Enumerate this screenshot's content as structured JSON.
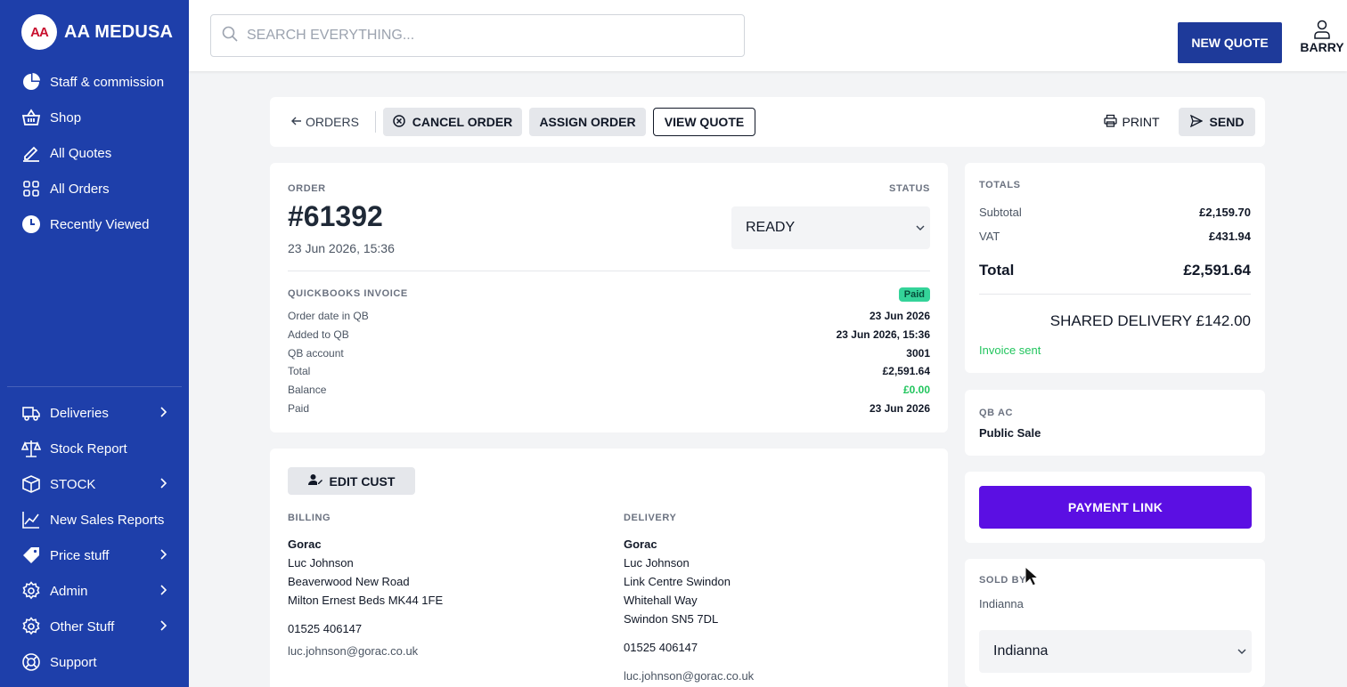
{
  "brand": {
    "logo_text": "AA",
    "name": "AA MEDUSA"
  },
  "sidebar": {
    "items": [
      {
        "label": "Staff & commission",
        "icon": "pie-chart-icon"
      },
      {
        "label": "Shop",
        "icon": "basket-icon"
      },
      {
        "label": "All Quotes",
        "icon": "pencil-icon"
      },
      {
        "label": "All Orders",
        "icon": "grid-icon"
      },
      {
        "label": "Recently Viewed",
        "icon": "clock-icon"
      }
    ],
    "lower_items": [
      {
        "label": "Deliveries",
        "icon": "truck-icon",
        "has_submenu": true
      },
      {
        "label": "Stock Report",
        "icon": "scale-icon",
        "has_submenu": false
      },
      {
        "label": "STOCK",
        "icon": "box-icon",
        "has_submenu": true
      },
      {
        "label": "New Sales Reports",
        "icon": "line-chart-icon",
        "has_submenu": false
      },
      {
        "label": "Price stuff",
        "icon": "tag-icon",
        "has_submenu": true
      },
      {
        "label": "Admin",
        "icon": "gear-icon",
        "has_submenu": true
      },
      {
        "label": "Other Stuff",
        "icon": "gear-icon",
        "has_submenu": true
      },
      {
        "label": "Support",
        "icon": "lifebuoy-icon",
        "has_submenu": false
      }
    ]
  },
  "topbar": {
    "search_placeholder": "SEARCH EVERYTHING...",
    "new_quote_label": "NEW QUOTE",
    "user_name": "BARRY"
  },
  "actions": {
    "back_label": "ORDERS",
    "cancel_label": "CANCEL ORDER",
    "assign_label": "ASSIGN ORDER",
    "view_quote_label": "VIEW QUOTE",
    "print_label": "PRINT",
    "send_label": "SEND"
  },
  "order": {
    "label": "ORDER",
    "number": "#61392",
    "date": "23 Jun 2026, 15:36",
    "status_label": "STATUS",
    "status_value": "READY"
  },
  "quickbooks": {
    "label": "QUICKBOOKS INVOICE",
    "badge": "Paid",
    "rows": [
      {
        "k": "Order date in QB",
        "v": "23 Jun 2026"
      },
      {
        "k": "Added to QB",
        "v": "23 Jun 2026, 15:36"
      },
      {
        "k": "QB account",
        "v": "3001"
      },
      {
        "k": "Total",
        "v": "£2,591.64"
      },
      {
        "k": "Balance",
        "v": "£0.00"
      },
      {
        "k": "Paid",
        "v": "23 Jun 2026"
      }
    ]
  },
  "customer": {
    "edit_label": "EDIT CUST",
    "billing": {
      "label": "BILLING",
      "company": "Gorac",
      "lines": [
        "Luc Johnson",
        "Beaverwood New Road",
        "Milton Ernest Beds MK44 1FE"
      ],
      "phone": "01525 406147",
      "email": "luc.johnson@gorac.co.uk"
    },
    "delivery": {
      "label": "DELIVERY",
      "company": "Gorac",
      "lines": [
        "Luc Johnson",
        "Link Centre Swindon",
        "Whitehall Way",
        "Swindon SN5 7DL"
      ],
      "phone": "01525 406147",
      "email": "luc.johnson@gorac.co.uk"
    }
  },
  "totals": {
    "label": "TOTALS",
    "subtotal_label": "Subtotal",
    "subtotal": "£2,159.70",
    "vat_label": "VAT",
    "vat": "£431.94",
    "total_label": "Total",
    "total": "£2,591.64",
    "shared_delivery": "SHARED DELIVERY £142.00",
    "invoice_status": "Invoice sent"
  },
  "qb_ac": {
    "label": "QB AC",
    "value": "Public Sale"
  },
  "payment": {
    "label": "PAYMENT LINK"
  },
  "sold_by": {
    "label": "SOLD BY",
    "value": "Indianna",
    "select_value": "Indianna"
  },
  "colors": {
    "sidebar": "#1e3faa",
    "primary": "#1e3a9a",
    "payment": "#5b0fe3",
    "paid_badge": "#34d399",
    "success_text": "#22c55e"
  }
}
